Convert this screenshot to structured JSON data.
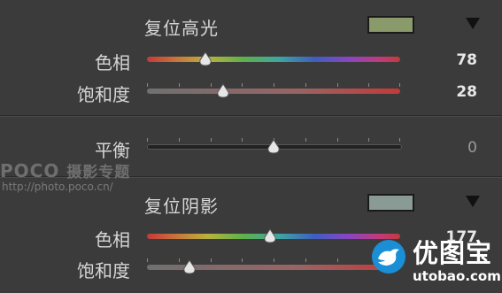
{
  "sections": [
    {
      "title": "复位高光",
      "swatch_color": "#8a9a6a",
      "rows": [
        {
          "label": "色相",
          "value": "78",
          "track": "hue",
          "thumb_fraction": 0.23
        },
        {
          "label": "饱和度",
          "value": "28",
          "track": "sat",
          "thumb_fraction": 0.3
        }
      ]
    },
    {
      "label": "平衡",
      "value": "0",
      "track": "balance",
      "thumb_fraction": 0.5
    },
    {
      "title": "复位阴影",
      "swatch_color": "#8a9a95",
      "rows": [
        {
          "label": "色相",
          "value": "177",
          "track": "hue",
          "thumb_fraction": 0.49
        },
        {
          "label": "饱和度",
          "value": "",
          "track": "sat",
          "thumb_fraction": 0.17
        }
      ]
    }
  ],
  "watermarks": {
    "poco_brand": "POCO",
    "poco_text": "摄影专题",
    "poco_url": "http://photo.poco.cn/",
    "utobao_brand": "优图宝",
    "utobao_domain": "utobao.com"
  },
  "colors": {
    "background": "#3b3b3b",
    "hue_start": "#c43a3a",
    "sat_end": "#c23a3a",
    "utobao_blue": "#1a8fd6"
  }
}
